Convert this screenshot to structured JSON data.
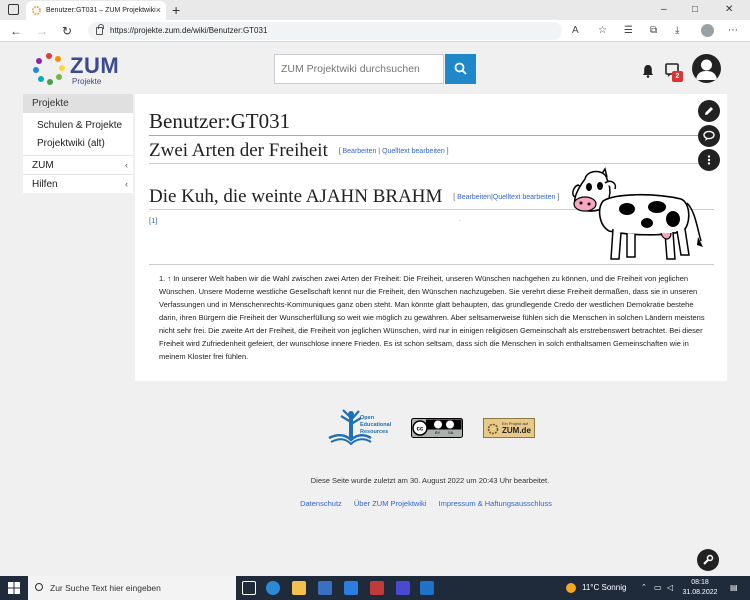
{
  "browser": {
    "tab_title": "Benutzer:GT031 – ZUM Projektwiki",
    "tab_close": "×",
    "new_tab": "+",
    "url": "https://projekte.zum.de/wiki/Benutzer:GT031",
    "window_controls": [
      "–",
      "□",
      "✕"
    ]
  },
  "header": {
    "logo_text": "ZUM",
    "logo_sub": "Projekte",
    "search_placeholder": "ZUM Projektwiki durchsuchen",
    "notification_count": "2"
  },
  "sidebar": {
    "head": "Projekte",
    "links": [
      "Schulen & Projekte",
      "Projektwiki (alt)"
    ],
    "sections": [
      {
        "label": "ZUM",
        "chevron": "‹"
      },
      {
        "label": "Hilfen",
        "chevron": "‹"
      }
    ]
  },
  "content": {
    "title": "Benutzer:GT031",
    "heading1": "Zwei Arten der Freiheit",
    "heading1_edit": "Bearbeiten",
    "heading1_source": "Quelltext bearbeiten",
    "heading2": "Die Kuh, die weinte AJAHN BRAHM",
    "heading2_edit": "Bearbeiten",
    "heading2_source": "Quelltext bearbeiten",
    "ref": "[1]",
    "footnote_marker": "1. ↑",
    "footnote": "In unserer Welt haben wir die Wahl zwischen zwei Arten der Freiheit: Die Freiheit, unseren Wünschen nachgehen zu können, und die Freiheit von jeglichen Wünschen. Unsere Moderne westliche Gesellschaft kennt nur die Freiheit, den Wünschen nachzugeben. Sie verehrt diese Freiheit dermaßen, dass sie in unseren Verfassungen und in Menschenrechts-Kommuniques ganz oben steht. Man könnte glatt behaupten, das grundlegende Credo der westlichen Demokratie bestehe darin, ihren Bürgern die Freiheit der Wunscherfüllung so weit wie möglich zu gewähren. Aber seltsamerweise fühlen sich die Menschen in solchen Ländern meistens nicht sehr frei. Die zweite Art der Freiheit, die Freiheit von jeglichen Wünschen, wird nur in einigen religiösen Gemeinschaft als erstrebenswert betrachtet. Bei dieser Freiheit wird Zufriedenheit gefeiert, der wunschlose innere Frieden. Es ist schon seltsam, dass sich die Menschen in solch enthaltsamen Gemeinschaften wie in meinem Kloster frei fühlen."
  },
  "footer": {
    "oer_lines": [
      "Open",
      "Educational",
      "Resources"
    ],
    "cc_labels": [
      "BY",
      "SA"
    ],
    "zumde_lines": [
      "Ein Projekt auf",
      "ZUM.de"
    ],
    "last_modified": "Diese Seite wurde zuletzt am 30. August 2022 um 20:43 Uhr bearbeitet.",
    "links": [
      "Datenschutz",
      "Über ZUM Projektwiki",
      "Impressum & Haftungsausschluss"
    ]
  },
  "taskbar": {
    "search_placeholder": "Zur Suche Text hier eingeben",
    "weather": "11°C  Sonnig",
    "time": "08:18",
    "date": "31.08.2022"
  },
  "colors": {
    "accent": "#1e88c8",
    "logo": "#3d4b8e",
    "link": "#3366cc",
    "badge": "#dd3333"
  }
}
